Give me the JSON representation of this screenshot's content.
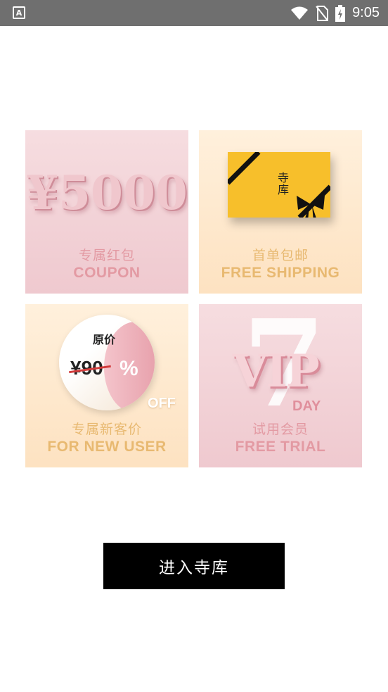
{
  "status_bar": {
    "notification_icon": "A",
    "time": "9:05",
    "icons": [
      "wifi-icon",
      "no-sim-icon",
      "battery-charging-icon"
    ]
  },
  "tiles": [
    {
      "graphic_text": "¥5000",
      "title_cn": "专属红包",
      "title_en": "COUPON"
    },
    {
      "graphic_text": "寺库",
      "title_cn": "首单包邮",
      "title_en": "FREE SHIPPING"
    },
    {
      "graphic_label": "原价",
      "graphic_price": "¥90",
      "graphic_percent": "%",
      "graphic_off": "OFF",
      "title_cn": "专属新客价",
      "title_en": "FOR NEW USER"
    },
    {
      "graphic_number": "7",
      "graphic_vip": "VIP",
      "graphic_day": "DAY",
      "title_cn": "试用会员",
      "title_en": "FREE TRIAL"
    }
  ],
  "enter_button": {
    "label": "进入寺库"
  },
  "colors": {
    "pink_text": "#e39aa3",
    "gold_text": "#e8b971",
    "button_bg": "#000000"
  }
}
